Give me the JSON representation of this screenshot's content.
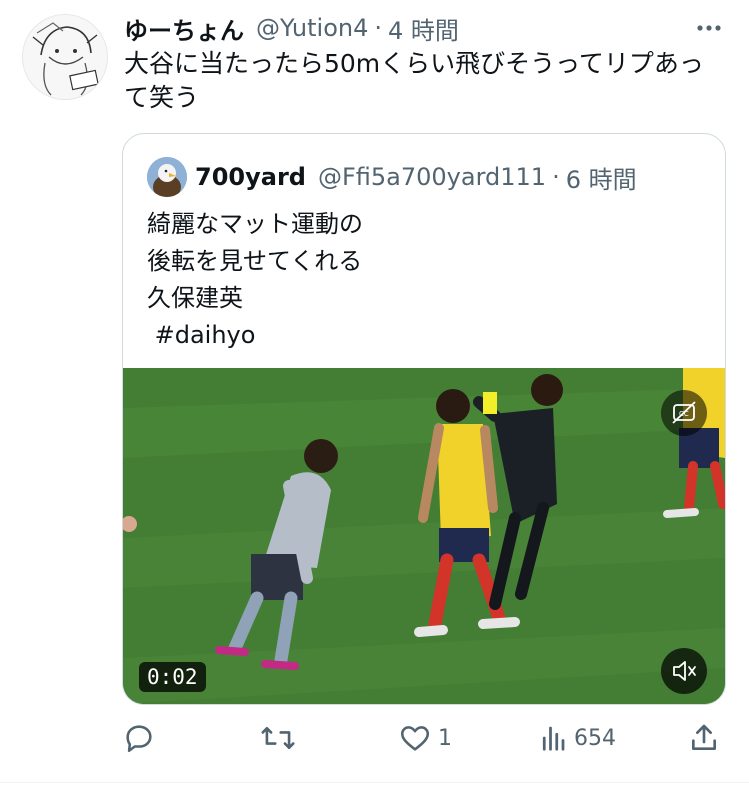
{
  "tweet": {
    "display_name": "ゆーちょん",
    "handle": "@Yution4",
    "separator": "·",
    "time": "4 時間",
    "text": "大谷に当たったら50mくらい飛びそうってリプあって笑う"
  },
  "quoted": {
    "display_name": "700yard",
    "handle": "@Ffi5a700yard111",
    "separator": "·",
    "time": "6 時間",
    "lines": [
      "綺麗なマット運動の",
      "後転を見せてくれる",
      "久保建英",
      " #daihyo"
    ],
    "video": {
      "timestamp": "0:02"
    }
  },
  "actions": {
    "reply": {
      "icon": "reply-icon"
    },
    "retweet": {
      "icon": "retweet-icon"
    },
    "like": {
      "icon": "heart-icon",
      "count": "1"
    },
    "views": {
      "icon": "views-icon",
      "count": "654"
    },
    "share": {
      "icon": "share-icon"
    }
  },
  "colors": {
    "text": "#0f1419",
    "muted": "#536471",
    "border": "#cfd9de",
    "pitch": "#4a8638"
  }
}
